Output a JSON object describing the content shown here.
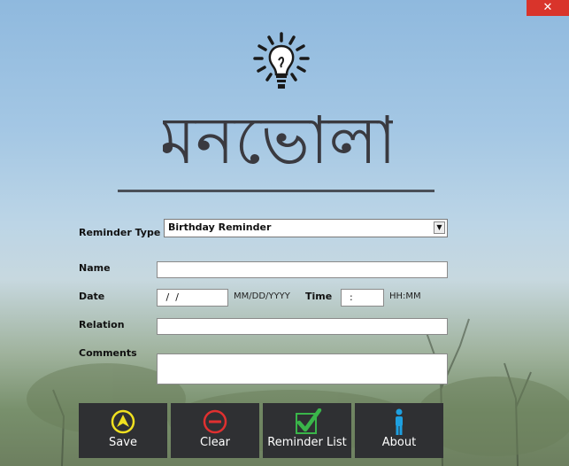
{
  "window": {
    "close_glyph": "✕"
  },
  "app_title": "মনভোলা",
  "form": {
    "reminder_type": {
      "label": "Reminder Type",
      "value": "Birthday Reminder"
    },
    "name": {
      "label": "Name",
      "value": ""
    },
    "date": {
      "label": "Date",
      "value": " /  /",
      "format_hint": "MM/DD/YYYY"
    },
    "time": {
      "label": "Time",
      "value": ":",
      "format_hint": "HH:MM"
    },
    "relation": {
      "label": "Relation",
      "value": ""
    },
    "comments": {
      "label": "Comments",
      "value": ""
    }
  },
  "buttons": [
    {
      "label": "Save",
      "icon": "save-icon"
    },
    {
      "label": "Clear",
      "icon": "clear-icon"
    },
    {
      "label": "Reminder List",
      "icon": "checkmark-icon"
    },
    {
      "label": "About",
      "icon": "person-icon"
    }
  ],
  "colors": {
    "close": "#d9342b",
    "button_bg": "#2f3033",
    "save_icon": "#f0e020",
    "clear_icon": "#e03030",
    "check_icon": "#3ab54a",
    "about_icon": "#1ea0e0"
  }
}
